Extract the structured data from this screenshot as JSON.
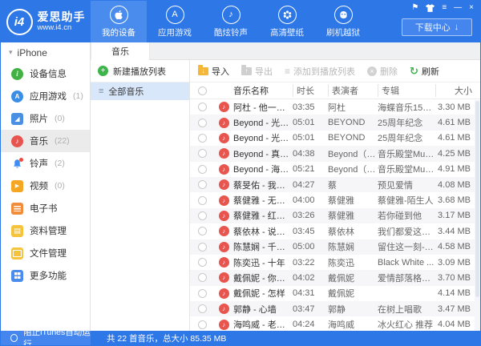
{
  "colors": {
    "accent_blue": "#2e77e6",
    "active_tab_blue": "#4a8cee",
    "status_left_blue": "#4586ee",
    "selected_playlist_blue": "#d9e7fb",
    "sidebar_selected_gray": "#ebebeb",
    "music_icon_red": "#e8544e",
    "green": "#3cb54a",
    "import_folder_yellow": "#f5b73a",
    "zebra_row_gray": "#f6f6f8"
  },
  "window_controls": {
    "flag": "⚑",
    "menu": "≡",
    "minimize": "—",
    "close": "×"
  },
  "header": {
    "logo": {
      "badge": "i4",
      "title": "爱思助手",
      "subtitle": "www.i4.cn"
    },
    "nav": [
      {
        "label": "我的设备",
        "icon": "apple-icon",
        "active": true
      },
      {
        "label": "应用游戏",
        "icon": "appstore-icon",
        "glyph": "A"
      },
      {
        "label": "酷炫铃声",
        "icon": "ringtone-icon",
        "glyph": "♪"
      },
      {
        "label": "高清壁纸",
        "icon": "wallpaper-icon"
      },
      {
        "label": "刷机越狱",
        "icon": "jailbreak-icon"
      }
    ],
    "download_button": {
      "label": "下载中心",
      "arrow": "↓"
    }
  },
  "sidebar": {
    "device_header": {
      "label": "iPhone",
      "caret": "▾"
    },
    "items": [
      {
        "label": "设备信息",
        "count": "",
        "icon": "device-info-icon"
      },
      {
        "label": "应用游戏",
        "count": "(1)",
        "icon": "apps-icon"
      },
      {
        "label": "照片",
        "count": "(0)",
        "icon": "photos-icon"
      },
      {
        "label": "音乐",
        "count": "(22)",
        "icon": "music-icon",
        "selected": true
      },
      {
        "label": "铃声",
        "count": "(2)",
        "icon": "ringtone-bell-icon"
      },
      {
        "label": "视频",
        "count": "(0)",
        "icon": "video-icon"
      },
      {
        "label": "电子书",
        "count": "",
        "icon": "ebook-icon"
      },
      {
        "label": "资料管理",
        "count": "",
        "icon": "data-manage-icon"
      },
      {
        "label": "文件管理",
        "count": "",
        "icon": "file-manage-icon"
      },
      {
        "label": "更多功能",
        "count": "",
        "icon": "more-features-icon"
      }
    ],
    "itunes_toggle": "阻止iTunes自动运行"
  },
  "main": {
    "tab_label": "音乐",
    "playlist_panel": {
      "new_playlist": "新建播放列表",
      "all_music": "全部音乐"
    },
    "toolbar": {
      "import": "导入",
      "export": "导出",
      "add_to_playlist": "添加到播放列表",
      "delete": "删除",
      "refresh": "刷新"
    },
    "table": {
      "columns": {
        "name": "音乐名称",
        "duration": "时长",
        "artist": "表演者",
        "album": "专辑",
        "size": "大小"
      },
      "rows": [
        {
          "name": "阿杜 - 他一定很爱你",
          "duration": "03:35",
          "artist": "阿杜",
          "album": "海蝶音乐15周...",
          "size": "3.30 MB"
        },
        {
          "name": "Beyond - 光辉岁月",
          "duration": "05:01",
          "artist": "BEYOND",
          "album": "25周年纪念",
          "size": "4.61 MB"
        },
        {
          "name": "Beyond - 光辉岁月",
          "duration": "05:01",
          "artist": "BEYOND",
          "album": "25周年纪念",
          "size": "4.61 MB"
        },
        {
          "name": "Beyond - 真的爱你",
          "duration": "04:38",
          "artist": "Beyond（黄...",
          "album": "音乐殿堂Musi...",
          "size": "4.25 MB"
        },
        {
          "name": "Beyond - 海阔天空",
          "duration": "05:21",
          "artist": "Beyond（黄...",
          "album": "音乐殿堂Musi...",
          "size": "4.91 MB"
        },
        {
          "name": "蔡旻佑 - 我可以",
          "duration": "04:27",
          "artist": "蔡",
          "album": "预见爱情",
          "size": "4.08 MB"
        },
        {
          "name": "蔡健雅 - 无底洞",
          "duration": "04:00",
          "artist": "蔡健雅",
          "album": "蔡健雅-陌生人",
          "size": "3.68 MB"
        },
        {
          "name": "蔡健雅 - 红色高跟鞋",
          "duration": "03:26",
          "artist": "蔡健雅",
          "album": "若你碰到他",
          "size": "3.17 MB"
        },
        {
          "name": "蔡依林 - 说爱你",
          "duration": "03:45",
          "artist": "蔡依林",
          "album": "我们都爱这个伦",
          "size": "3.44 MB"
        },
        {
          "name": "陈慧娴 - 千千阕歌",
          "duration": "05:00",
          "artist": "陈慧娴",
          "album": "留住这一刻-陈...",
          "size": "4.58 MB"
        },
        {
          "name": "陈奕迅 - 十年",
          "duration": "03:22",
          "artist": "陈奕迅",
          "album": "Black White ...",
          "size": "3.09 MB"
        },
        {
          "name": "戴佩妮 - 你要的爱",
          "duration": "04:02",
          "artist": "戴佩妮",
          "album": "爱情部落格2之...",
          "size": "3.70 MB"
        },
        {
          "name": "戴佩妮 - 怎样",
          "duration": "04:31",
          "artist": "戴佩妮",
          "album": "",
          "size": "4.14 MB"
        },
        {
          "name": "郭静 - 心墙",
          "duration": "03:47",
          "artist": "郭静",
          "album": "在树上唱歌",
          "size": "3.47 MB"
        },
        {
          "name": "海鸣威 - 老人与海",
          "duration": "04:24",
          "artist": "海鸣威",
          "album": "冰火红心 推荐",
          "size": "4.04 MB"
        }
      ]
    }
  },
  "statusbar": {
    "summary": "共 22 首音乐，总大小 85.35 MB"
  },
  "icons": {
    "note": "♪"
  }
}
